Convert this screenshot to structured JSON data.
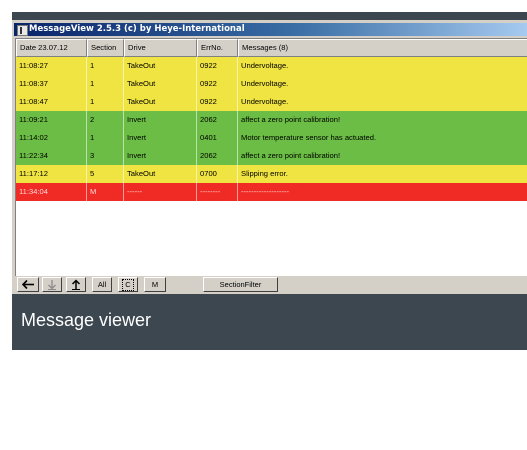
{
  "window": {
    "title": "MessageView 2.5.3 (c) by Heye-International"
  },
  "table": {
    "headers": [
      "Date 23.07.12",
      "Section",
      "Drive",
      "ErrNo.",
      "Messages (8)"
    ],
    "rows": [
      {
        "status": "warning",
        "cells": [
          "11:08:27",
          "1",
          "TakeOut",
          "0922",
          "Undervoltage."
        ]
      },
      {
        "status": "warning",
        "cells": [
          "11:08:37",
          "1",
          "TakeOut",
          "0922",
          "Undervoltage."
        ]
      },
      {
        "status": "warning",
        "cells": [
          "11:08:47",
          "1",
          "TakeOut",
          "0922",
          "Undervoltage."
        ]
      },
      {
        "status": "ok",
        "cells": [
          "11:09:21",
          "2",
          "Invert",
          "2062",
          "affect a zero point calibration!"
        ]
      },
      {
        "status": "ok",
        "cells": [
          "11:14:02",
          "1",
          "Invert",
          "0401",
          "Motor temperature sensor has actuated."
        ]
      },
      {
        "status": "ok",
        "cells": [
          "11:22:34",
          "3",
          "Invert",
          "2062",
          "affect a zero point calibration!"
        ]
      },
      {
        "status": "warning",
        "cells": [
          "11:17:12",
          "5",
          "TakeOut",
          "0700",
          "Slipping error."
        ]
      },
      {
        "status": "error",
        "cells": [
          "11:34:04",
          "M",
          "------",
          "--------",
          "-------------------"
        ]
      }
    ]
  },
  "colors": {
    "warning": "#f0e442",
    "ok": "#6bbd45",
    "error": "#f02a24"
  },
  "toolbar": {
    "back_icon": "arrow-left-icon",
    "down_icon": "arrow-down-icon",
    "up_icon": "arrow-up-icon",
    "all_label": "All",
    "c_label": "C",
    "m_label": "M",
    "section_filter_label": "SectionFilter"
  },
  "caption": {
    "text": "Message viewer"
  }
}
